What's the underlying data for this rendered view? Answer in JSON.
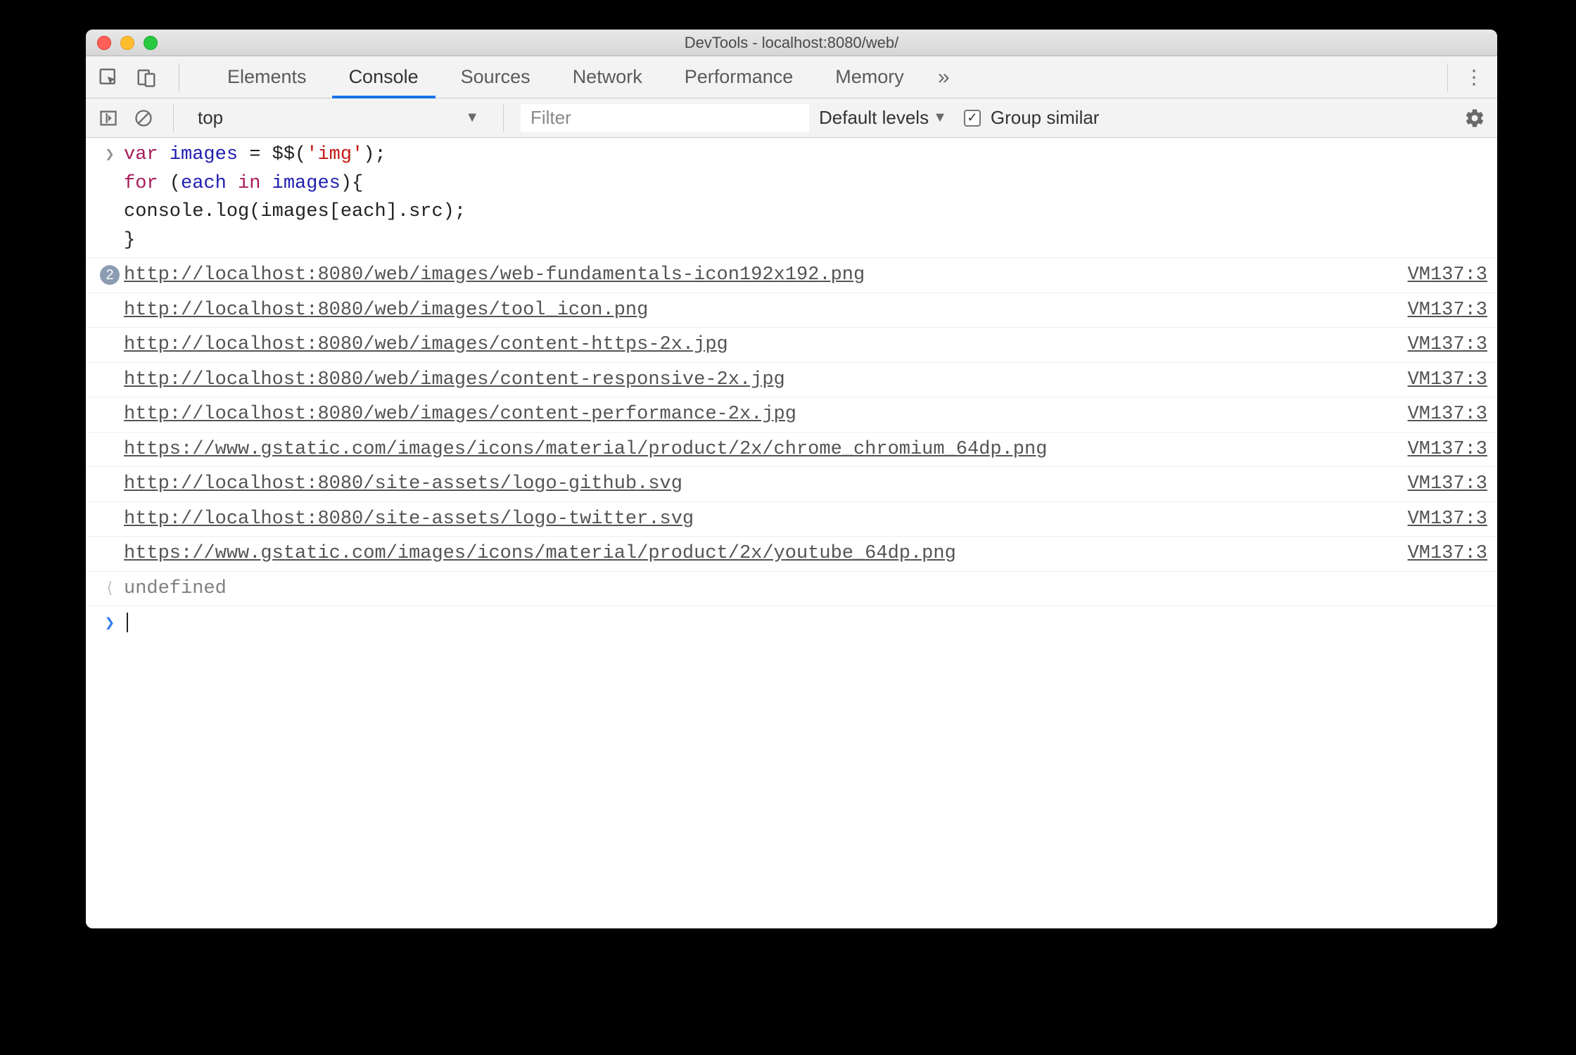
{
  "window": {
    "title": "DevTools - localhost:8080/web/"
  },
  "tabs": {
    "items": [
      "Elements",
      "Console",
      "Sources",
      "Network",
      "Performance",
      "Memory"
    ],
    "overflow": "»",
    "active_index": 1
  },
  "filterbar": {
    "context": "top",
    "filter_placeholder": "Filter",
    "levels_label": "Default levels",
    "group_similar_label": "Group similar",
    "group_similar_checked": true
  },
  "console": {
    "input_code": {
      "line1_kw1": "var",
      "line1_ident": "images",
      "line1_plain1": " = ",
      "line1_func": "$$",
      "line1_plain2": "(",
      "line1_str": "'img'",
      "line1_plain3": ");",
      "line2_kw1": "for",
      "line2_plain1": " (",
      "line2_ident1": "each",
      "line2_kw2": "in",
      "line2_ident2": "images",
      "line2_plain2": "){",
      "line3_plain": "    console.log(images[each].src);",
      "line4_plain": "}"
    },
    "logs": [
      {
        "badge": "2",
        "url": "http://localhost:8080/web/images/web-fundamentals-icon192x192.png",
        "source": "VM137:3"
      },
      {
        "badge": "",
        "url": "http://localhost:8080/web/images/tool_icon.png",
        "source": "VM137:3"
      },
      {
        "badge": "",
        "url": "http://localhost:8080/web/images/content-https-2x.jpg",
        "source": "VM137:3"
      },
      {
        "badge": "",
        "url": "http://localhost:8080/web/images/content-responsive-2x.jpg",
        "source": "VM137:3"
      },
      {
        "badge": "",
        "url": "http://localhost:8080/web/images/content-performance-2x.jpg",
        "source": "VM137:3"
      },
      {
        "badge": "",
        "url": "https://www.gstatic.com/images/icons/material/product/2x/chrome_chromium_64dp.png",
        "source": "VM137:3"
      },
      {
        "badge": "",
        "url": "http://localhost:8080/site-assets/logo-github.svg",
        "source": "VM137:3"
      },
      {
        "badge": "",
        "url": "http://localhost:8080/site-assets/logo-twitter.svg",
        "source": "VM137:3"
      },
      {
        "badge": "",
        "url": "https://www.gstatic.com/images/icons/material/product/2x/youtube_64dp.png",
        "source": "VM137:3"
      }
    ],
    "result": "undefined"
  }
}
